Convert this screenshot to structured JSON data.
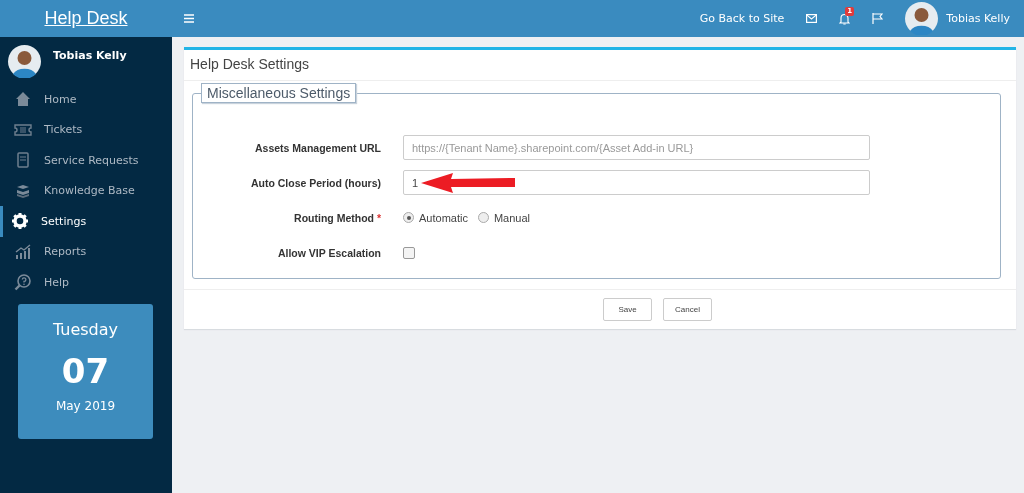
{
  "sidebar": {
    "title": "Help Desk",
    "user": {
      "name": "Tobias Kelly"
    },
    "items": [
      {
        "label": "Home",
        "selected": false
      },
      {
        "label": "Tickets",
        "selected": false
      },
      {
        "label": "Service Requests",
        "selected": false
      },
      {
        "label": "Knowledge Base",
        "selected": false
      },
      {
        "label": "Settings",
        "selected": true
      },
      {
        "label": "Reports",
        "selected": false
      },
      {
        "label": "Help",
        "selected": false
      }
    ],
    "date": {
      "weekday": "Tuesday",
      "day": "07",
      "month_year": "May 2019"
    }
  },
  "topbar": {
    "link": "Go Back to Site",
    "notification_count": "1",
    "user": "Tobias Kelly"
  },
  "panel": {
    "title": "Help Desk Settings",
    "section": "Miscellaneous Settings",
    "fields": [
      {
        "kind": "text",
        "label": "Assets Management URL",
        "placeholder": "https://{Tenant Name}.sharepoint.com/{Asset Add-in URL}"
      },
      {
        "kind": "text",
        "label": "Auto Close Period (hours)",
        "value": "1",
        "annotated": true
      },
      {
        "kind": "radio",
        "label": "Routing Method",
        "required": "*",
        "options": [
          {
            "label": "Automatic",
            "selected": true
          },
          {
            "label": "Manual",
            "selected": false
          }
        ]
      },
      {
        "kind": "checkbox",
        "label": "Allow VIP Escalation",
        "checked": false
      }
    ],
    "buttons": [
      "Save",
      "Cancel"
    ]
  }
}
